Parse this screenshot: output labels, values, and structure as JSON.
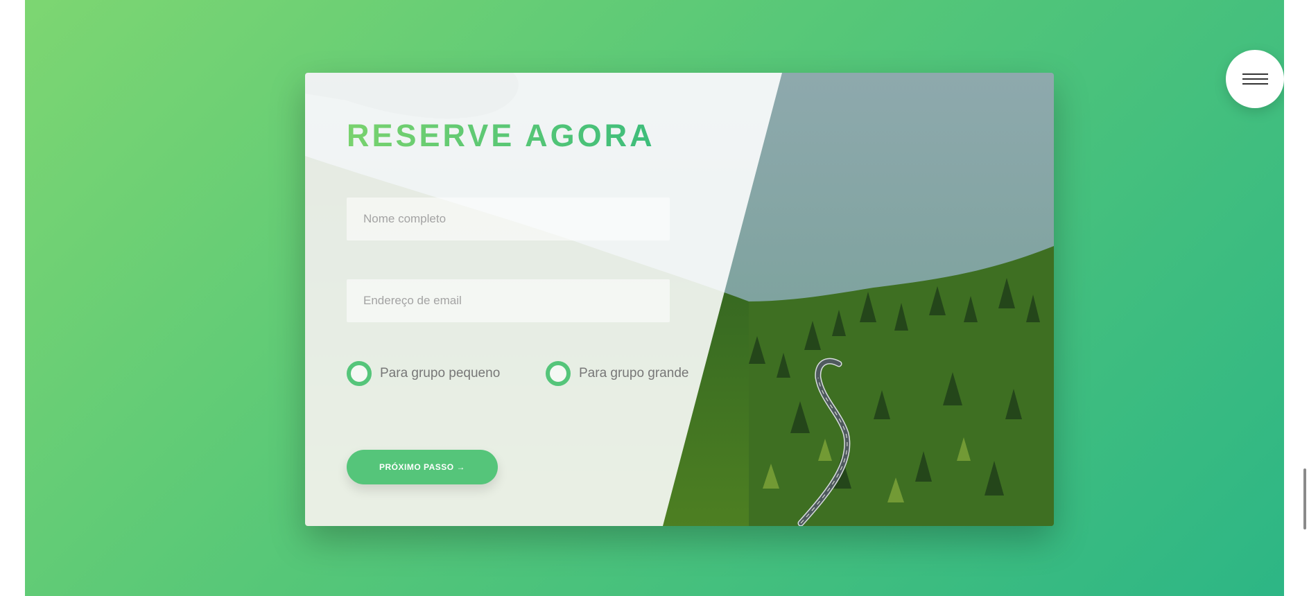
{
  "booking": {
    "title": "RESERVE AGORA",
    "name_placeholder": "Nome completo",
    "email_placeholder": "Endereço de email",
    "option_small": "Para grupo pequeno",
    "option_large": "Para grupo grande",
    "next_button": "PRÓXIMO PASSO →"
  },
  "colors": {
    "accent": "#55c57a",
    "gradient_start": "#7ed56f",
    "gradient_end": "#28b485"
  },
  "icons": {
    "menu": "hamburger-menu-icon"
  }
}
